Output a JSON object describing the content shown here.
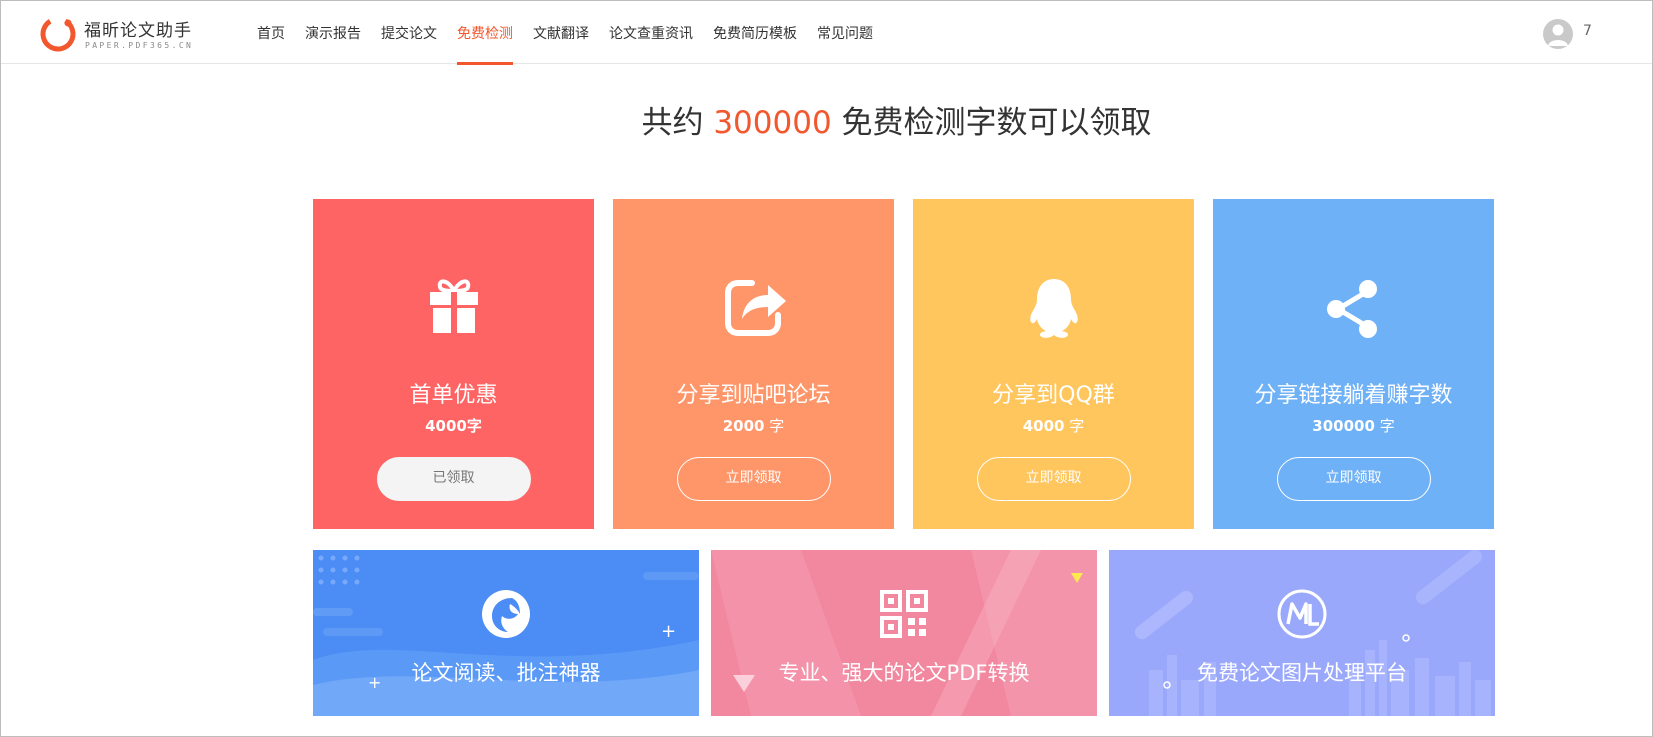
{
  "brand": {
    "name": "福昕论文助手",
    "domain": "PAPER.PDF365.CN",
    "accent": "#f2572d"
  },
  "nav": {
    "items": [
      {
        "label": "首页",
        "active": false
      },
      {
        "label": "演示报告",
        "active": false
      },
      {
        "label": "提交论文",
        "active": false
      },
      {
        "label": "免费检测",
        "active": true
      },
      {
        "label": "文献翻译",
        "active": false
      },
      {
        "label": "论文查重资讯",
        "active": false
      },
      {
        "label": "免费简历模板",
        "active": false
      },
      {
        "label": "常见问题",
        "active": false
      }
    ]
  },
  "user": {
    "avatar_icon": "user-avatar-icon",
    "count": "7"
  },
  "headline": {
    "prefix": "共约",
    "number": "300000",
    "suffix": "免费检测字数可以领取"
  },
  "cards": [
    {
      "icon": "gift-icon",
      "title": "首单优惠",
      "amount": "4000字",
      "unit": "",
      "button": "已领取",
      "claimed": true,
      "color": "#ff6464"
    },
    {
      "icon": "share-out-icon",
      "title": "分享到贴吧论坛",
      "amount": "2000",
      "unit": "字",
      "button": "立即领取",
      "claimed": false,
      "color": "#ff966a"
    },
    {
      "icon": "qq-penguin-icon",
      "title": "分享到QQ群",
      "amount": "4000",
      "unit": "字",
      "button": "立即领取",
      "claimed": false,
      "color": "#ffc65e"
    },
    {
      "icon": "share-nodes-icon",
      "title": "分享链接躺着赚字数",
      "amount": "300000",
      "unit": "字",
      "button": "立即领取",
      "claimed": false,
      "color": "#6fb1f6"
    }
  ],
  "banners": [
    {
      "icon": "foxit-reader-icon",
      "title": "论文阅读、批注神器",
      "color": "#4b8cf5"
    },
    {
      "icon": "qr-grid-icon",
      "title": "专业、强大的论文PDF转换",
      "color": "#f2889f"
    },
    {
      "icon": "ml-logo-icon",
      "title": "免费论文图片处理平台",
      "color": "#9aa8fb"
    }
  ]
}
